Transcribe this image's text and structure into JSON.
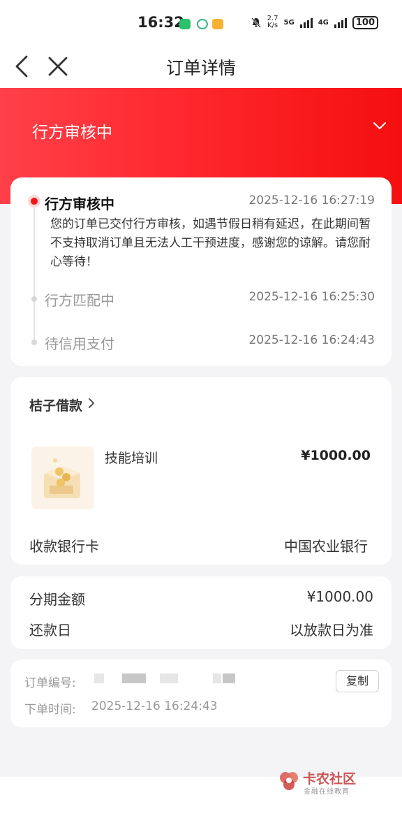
{
  "status_bar": {
    "time": "16:32",
    "net_speed_top": "2.7",
    "net_speed_bottom": "K/s",
    "net1": "5G",
    "net2": "4G",
    "battery": "100"
  },
  "nav": {
    "title": "订单详情",
    "back_icon": "back-arrow",
    "close_icon": "close"
  },
  "header": {
    "status": "行方审核中"
  },
  "timeline": [
    {
      "title": "行方审核中",
      "time": "2025-12-16 16:27:19",
      "desc": "您的订单已交付行方审核，如遇节假日稍有延迟，在此期间暂不支持取消订单且无法人工干预进度，感谢您的谅解。请您耐心等待！"
    },
    {
      "title": "行方匹配中",
      "time": "2025-12-16 16:25:30"
    },
    {
      "title": "待信用支付",
      "time": "2025-12-16 16:24:43"
    }
  ],
  "product": {
    "merchant": "桔子借款",
    "name": "技能培训",
    "price": "¥1000.00",
    "bank_label": "收款银行卡",
    "bank_value": "中国农业银行"
  },
  "installment": {
    "amount_label": "分期金额",
    "amount_value": "¥1000.00",
    "repay_label": "还款日",
    "repay_value": "以放款日为准"
  },
  "order": {
    "number_label": "订单编号:",
    "copy_label": "复制",
    "time_label": "下单时间:",
    "time_value": "2025-12-16 16:24:43"
  },
  "watermark": {
    "name": "卡农社区",
    "sub": "金融在线教育"
  },
  "colors": {
    "accent": "#f4141c",
    "header_gradient_start": "#ff4049",
    "header_gradient_end": "#f50f10"
  }
}
